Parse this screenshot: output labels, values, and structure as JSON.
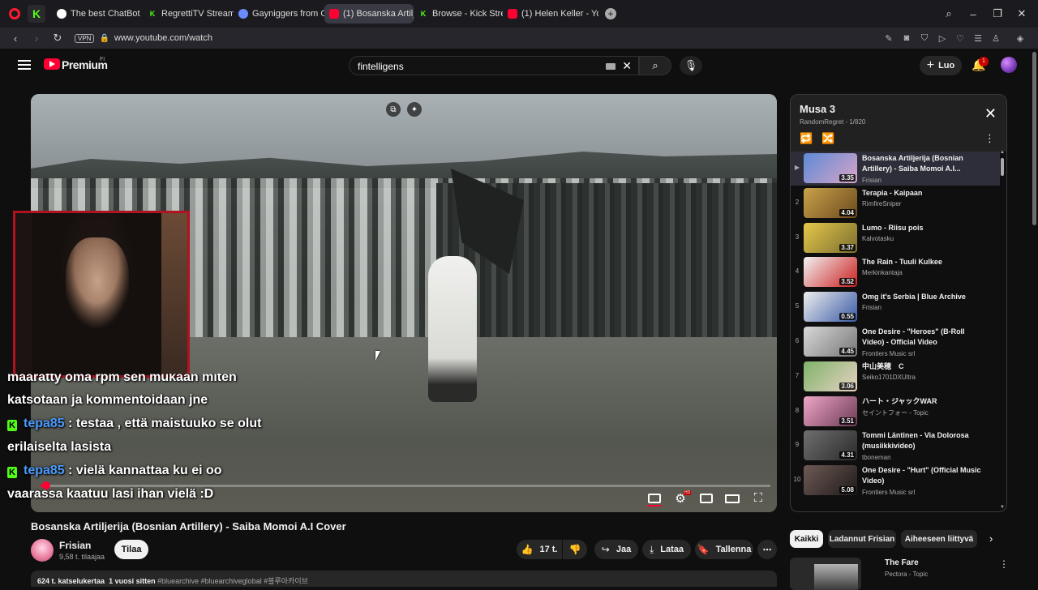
{
  "browser": {
    "tabs": [
      {
        "label": "The best ChatBot and Wid",
        "favicon": "gpt"
      },
      {
        "label": "RegrettiTV Stream - Watc",
        "favicon": "kick"
      },
      {
        "label": "Gayniggers from Outer Sp",
        "favicon": "gay"
      },
      {
        "label": "(1) Bosanska Artiljerija (Bo",
        "favicon": "yt",
        "active": true
      },
      {
        "label": "Browse - Kick Streaming",
        "favicon": "kick"
      },
      {
        "label": "(1) Helen Keller - YouTube",
        "favicon": "yt"
      }
    ],
    "new_tab_label": "+",
    "vpn_label": "VPN",
    "url": "www.youtube.com/watch"
  },
  "header": {
    "brand": "Premium",
    "region": "FI",
    "search_value": "fintelligens",
    "create_label": "Luo",
    "notification_count": "1"
  },
  "video": {
    "chat": [
      {
        "type": "cut",
        "text": "määrätty oma rpm sen mukaan miten"
      },
      {
        "type": "plain",
        "text": "katsotaan ja kommentoidaan jne"
      },
      {
        "type": "msg",
        "user": "tepa85",
        "text": " : testaa , että maistuuko se olut"
      },
      {
        "type": "plain",
        "text": "erilaiselta lasista"
      },
      {
        "type": "msg",
        "user": "tepa85",
        "text": " : vielä kannattaa ku ei oo"
      },
      {
        "type": "plain",
        "text": "vaarassa kaatuu lasi ihan vielä :D"
      }
    ],
    "progress_fraction": 0.008,
    "hd_badge": "HD",
    "title": "Bosanska Artiljerija (Bosnian Artillery) - Saiba Momoi A.I Cover",
    "channel": "Frisian",
    "subscribers": "9,58 t. tilaajaa",
    "subscribe_label": "Tilaa",
    "likes": "17 t.",
    "share_label": "Jaa",
    "download_label": "Lataa",
    "save_label": "Tallenna",
    "views": "624 t. katselukertaa",
    "age": "1 vuosi sitten",
    "tags": "#bluearchive #bluearchiveglobal #블루아카이브"
  },
  "playlist": {
    "title": "Musa 3",
    "subtitle": "RandomRegret - 1/820",
    "items": [
      {
        "index": "▶",
        "title": "Bosanska Artiljerija (Bosnian Artillery) - Saiba Momoi A.I...",
        "channel": "Frisian",
        "duration": "3.35",
        "current": true,
        "thumb": [
          "#5d8ad6",
          "#d9a4c8"
        ]
      },
      {
        "index": "2",
        "title": "Terapia - Kaipaan",
        "channel": "RimfireSniper",
        "duration": "4.04",
        "thumb": [
          "#c9a24a",
          "#6b4a1e"
        ]
      },
      {
        "index": "3",
        "title": "Lumo - Riisu pois",
        "channel": "Kalvotasku",
        "duration": "3.37",
        "thumb": [
          "#e5c84a",
          "#7b6d2f"
        ]
      },
      {
        "index": "4",
        "title": "The Rain - Tuuli Kulkee",
        "channel": "Merkinkantaja",
        "duration": "3.52",
        "thumb": [
          "#f2f2f2",
          "#cc1f1f"
        ]
      },
      {
        "index": "5",
        "title": "Omg it's Serbia | Blue Archive",
        "channel": "Frisian",
        "duration": "0.55",
        "thumb": [
          "#eeeeee",
          "#3a5aa6"
        ]
      },
      {
        "index": "6",
        "title": "One Desire - \"Heroes\" (B-Roll Video) - Official Video",
        "channel": "Frontiers Music srl",
        "duration": "4.45",
        "thumb": [
          "#d8d8d8",
          "#777777"
        ]
      },
      {
        "index": "7",
        "title": "中山美穂　C",
        "channel": "Seiko1701DXUltra",
        "duration": "3.06",
        "thumb": [
          "#7fb36a",
          "#e7d2c2"
        ]
      },
      {
        "index": "8",
        "title": "ハート・ジャックWAR",
        "channel": "セイントフォー - Topic",
        "duration": "3.51",
        "thumb": [
          "#f0a6c6",
          "#6a3a55"
        ]
      },
      {
        "index": "9",
        "title": "Tommi Läntinen - Via Dolorosa (musiikkivideo)",
        "channel": "tboneman",
        "duration": "4.31",
        "thumb": [
          "#6f6f6f",
          "#2a2a2a"
        ]
      },
      {
        "index": "10",
        "title": "One Desire - \"Hurt\" (Official Music Video)",
        "channel": "Frontiers Music srl",
        "duration": "5.08",
        "thumb": [
          "#6f5a55",
          "#1e1a1a"
        ]
      }
    ]
  },
  "chips": [
    "Kaikki",
    "Ladannut Frisian",
    "Aiheeseen liittyvä"
  ],
  "recommendation": {
    "title": "The Fare",
    "channel": "Pectora - Topic"
  }
}
